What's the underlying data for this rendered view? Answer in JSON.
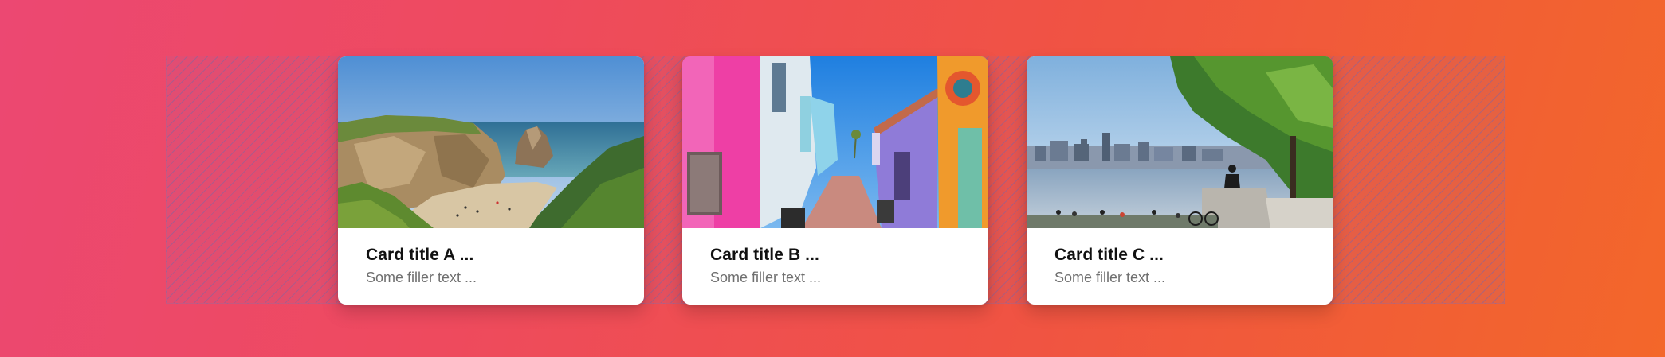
{
  "cards": [
    {
      "title": "Card title A ...",
      "text": "Some filler text ...",
      "image_subject": "coastal cliffs and beach with sea rock"
    },
    {
      "title": "Card title B ...",
      "text": "Some filler text ...",
      "image_subject": "colorful painted alley with pink and purple houses"
    },
    {
      "title": "Card title C ...",
      "text": "Some filler text ...",
      "image_subject": "waterfront with city skyline, people sitting and a tree"
    }
  ]
}
